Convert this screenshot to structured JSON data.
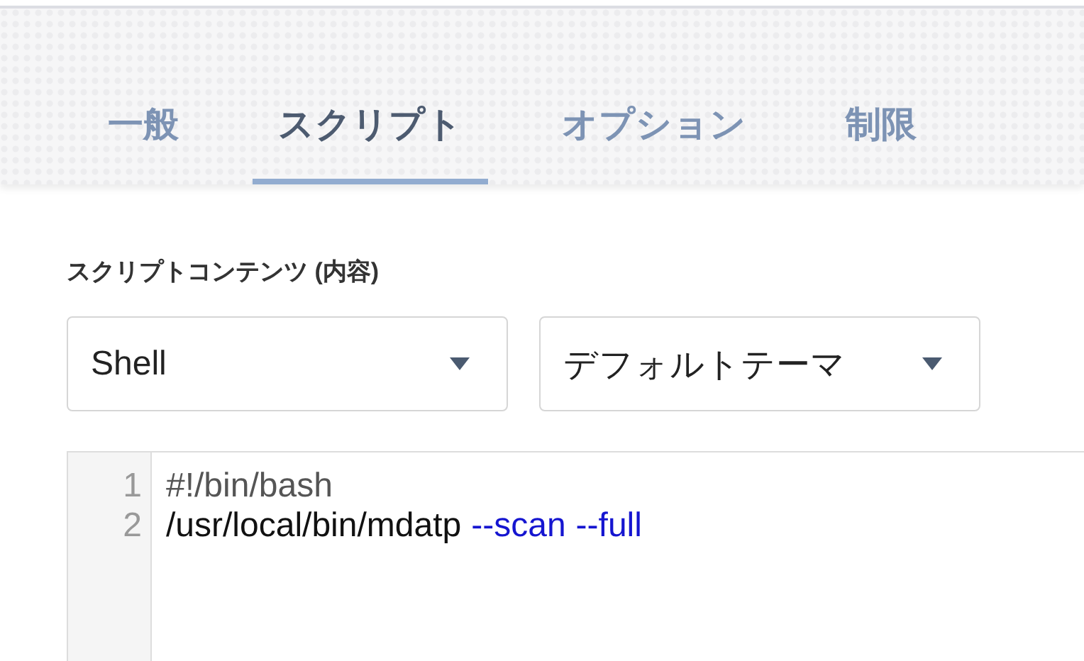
{
  "tabs": [
    {
      "label": "一般",
      "selected": false
    },
    {
      "label": "スクリプト",
      "selected": true
    },
    {
      "label": "オプション",
      "selected": false
    },
    {
      "label": "制限",
      "selected": false
    }
  ],
  "section_label": "スクリプトコンテンツ (内容)",
  "dropdowns": [
    {
      "value": "Shell"
    },
    {
      "value": "デフォルトテーマ"
    }
  ],
  "editor": {
    "lines": [
      {
        "number": "1",
        "tokens": [
          {
            "kind": "comment",
            "text": "#!/bin/bash"
          }
        ]
      },
      {
        "number": "2",
        "tokens": [
          {
            "kind": "plain",
            "text": "/usr/local/bin/mdatp"
          },
          {
            "kind": "flag",
            "text": "--scan"
          },
          {
            "kind": "flag",
            "text": "--full"
          }
        ]
      }
    ]
  }
}
